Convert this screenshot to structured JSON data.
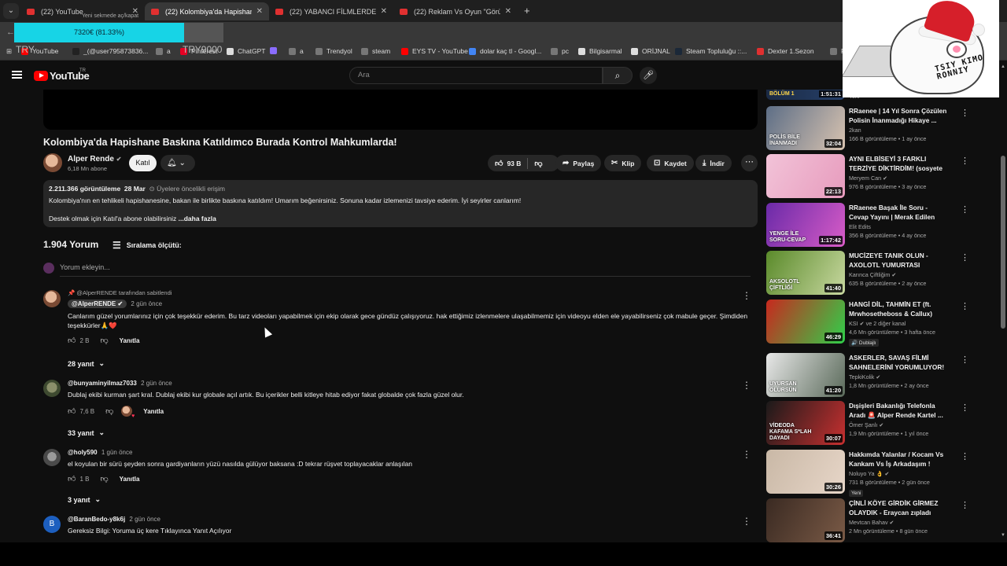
{
  "browser": {
    "tabs": [
      {
        "title": "(22) YouTube",
        "active": false
      },
      {
        "title": "(22) Kolombiya'da Hapishane B",
        "active": true
      },
      {
        "title": "(22) YABANCI FİLMLERDEKİ, TÜ",
        "active": false
      },
      {
        "title": "(22) Reklam Vs Oyun \"Göründü",
        "active": false
      }
    ],
    "new_tab": "+",
    "download_overlay_small": "Yeni sekmede aç/kapat",
    "download_progress": {
      "text": "7320€ (81.33%)",
      "fraction": 0.8133
    },
    "overlay_left": "TRY",
    "overlay_right": "TRY9000",
    "bookmarks": [
      {
        "label": "YouTube",
        "color": "#ff0000"
      },
      {
        "label": "_(@user795873836...",
        "color": "#222222"
      },
      {
        "label": "a",
        "color": "#777777"
      },
      {
        "label": "Pinterest",
        "color": "#e60023"
      },
      {
        "label": "ChatGPT",
        "color": "#dddddd"
      },
      {
        "label": "",
        "color": "#8a6cff"
      },
      {
        "label": "a",
        "color": "#777777"
      },
      {
        "label": "Trendyol",
        "color": "#777777"
      },
      {
        "label": "steam",
        "color": "#777777"
      },
      {
        "label": "EYS TV - YouTube",
        "color": "#ff0000"
      },
      {
        "label": "dolar kaç tl - Googl...",
        "color": "#4285f4"
      },
      {
        "label": "pc",
        "color": "#777777"
      },
      {
        "label": "Bilgisarmal",
        "color": "#dddddd"
      },
      {
        "label": "ORİJNAL",
        "color": "#dddddd"
      },
      {
        "label": "Steam Topluluğu ::...",
        "color": "#1b2838"
      },
      {
        "label": "Dexter 1.Sezon",
        "color": "#e03030"
      },
      {
        "label": "RDR",
        "color": "#777777"
      }
    ]
  },
  "youtube": {
    "logo_text": "YouTube",
    "country": "TR",
    "search_placeholder": "Ara",
    "video": {
      "title": "Kolombiya'da Hapishane Baskına Katıldımco Burada Kontrol Mahkumlarda!",
      "channel": "Alper Rende",
      "subscribers": "6,18 Mn abone",
      "join_label": "Katıl",
      "likes": "93 B",
      "share_label": "Paylaş",
      "clip_label": "Klip",
      "save_label": "Kaydet",
      "download_label": "İndir",
      "views": "2.211.366 görüntüleme",
      "date": "28 Mar",
      "members_note": "⊙ Üyelere öncelikli erişim",
      "description_line1": "Kolombiya'nın en tehlikeli hapishanesine, bakan ile birlikte baskına katıldım! Umarım beğenirsiniz. Sonuna kadar izlemenizi tavsiye ederim. İyi seyirler canlarım!",
      "description_line2": "Destek olmak için Katıl'a abone olabilirsiniz",
      "more_label": "...daha fazla"
    },
    "comments_header": {
      "count": "1.904 Yorum",
      "sort_label": "Sıralama ölçütü:",
      "add_placeholder": "Yorum ekleyin..."
    },
    "comments": [
      {
        "pinned": "📌 @AlperRENDE tarafından sabitlendi",
        "author": "@AlperRENDE ✔",
        "time": "2 gün önce",
        "text": "Canlarım güzel yorumlarınız için çok teşekkür ederim. Bu tarz videoları yapabilmek için ekip olarak gece gündüz çalışıyoruz. hak ettiğimiz izlenmelere ulaşabilmemiz için videoyu elden ele yayabilirseniz çok mabule geçer. Şimdiden teşekkürler🙏❤️",
        "likes": "2 B",
        "reply_label": "Yanıtla",
        "replies": "28 yanıt"
      },
      {
        "author": "@bunyaminyilmaz7033",
        "time": "2 gün önce",
        "text": "Dublaj ekibi kurman şart kral. Dublaj ekibi kur globale açıl artık. Bu içerikler belli kitleye hitab ediyor fakat globalde çok fazla güzel olur.",
        "likes": "7,6 B",
        "reply_label": "Yanıtla",
        "replies": "33 yanıt"
      },
      {
        "author": "@holy590",
        "time": "1 gün önce",
        "text": "el koyulan bir sürü şeyden sonra gardiyanların yüzü nasılda gülüyor baksana :D tekrar rüşvet toplayacaklar anlaşılan",
        "likes": "1 B",
        "reply_label": "Yanıtla",
        "replies": "3 yanıt"
      },
      {
        "author": "@BaranBedo-y8k6j",
        "time": "2 gün önce",
        "text": "Gereksiz Bilgi: Yoruma üç kere Tıklayınca Yanıt Açılıyor",
        "avatar_letter": "B"
      }
    ],
    "sidebar_partial": {
      "duration": "1:51:31",
      "caption": "BÖLÜM 1",
      "meta": "Yeni"
    },
    "sidebar": [
      {
        "title": "RRaenee | 14 Yıl Sonra Çözülen Polisin İnanmadığı Hikaye ...",
        "channel": "2kan",
        "meta": "166 B görüntüleme • 1 ay önce",
        "duration": "32:04",
        "caption": "POLİS BİLE İNANMADI",
        "c1": "#5d6e86",
        "c2": "#d8c3b0"
      },
      {
        "title": "AYNI ELBİSEYİ 3 FARKLI TERZİYE DİKTİRDİM! (sosyete ...",
        "channel": "Meryem Can ✔",
        "meta": "976 B görüntüleme • 3 ay önce",
        "duration": "22:13",
        "caption": "",
        "c1": "#f2c3d8",
        "c2": "#e79bbd"
      },
      {
        "title": "RRaenee Başak İle Soru - Cevap Yayını | Merak Edilen Tüm ...",
        "channel": "Elit Edits",
        "meta": "356 B görüntüleme • 4 ay önce",
        "duration": "1:17:42",
        "caption": "YENGE İLE SORU-CEVAP",
        "c1": "#6a2aa8",
        "c2": "#d85cc7"
      },
      {
        "title": "MUCİZEYE TANIK OLUN - AXOLOTL YUMURTASI",
        "channel": "Karınca Çiftliğim ✔",
        "meta": "635 B görüntüleme • 2 ay önce",
        "duration": "41:40",
        "caption": "AKSOLOTL ÇİFTLİĞİ",
        "c1": "#5a8a2a",
        "c2": "#c8d8a0"
      },
      {
        "title": "HANGİ DİL, TAHMİN ET (ft. Mrwhosetheboss & Callux)",
        "channel": "KSI ✔ ve 2 diğer kanal",
        "meta": "4,6 Mn görüntüleme • 3 hafta önce",
        "duration": "46:29",
        "caption": "",
        "badge": "🔊 Dublajlı",
        "c1": "#c8281e",
        "c2": "#2fd04a"
      },
      {
        "title": "ASKERLER, SAVAŞ FİLMİ SAHNELERİNİ YORUMLUYOR!",
        "channel": "TepkiKolik ✔",
        "meta": "1,8 Mn görüntüleme • 2 ay önce",
        "duration": "41:20",
        "caption": "UYURSAN ÖLÜRSÜN",
        "c1": "#e8e8e8",
        "c2": "#5a6a5a"
      },
      {
        "title": "Dışişleri Bakanlığı Telefonla Aradı 🚨 Alper Rende Kartel ...",
        "channel": "Ömer Şanlı ✔",
        "meta": "1,9 Mn görüntüleme • 1 yıl önce",
        "duration": "30:07",
        "caption": "VİDEODA KAFAMA S*LAH DAYADI",
        "c1": "#1a1a1a",
        "c2": "#c83030"
      },
      {
        "title": "Hakkımda Yalanlar / Kocam Vs Kankam Vs İş Arkadaşım !",
        "channel": "Noluyo Ya 👌 ✔",
        "meta": "731 B görüntüleme • 2 gün önce",
        "duration": "30:26",
        "caption": "",
        "badge": "Yeni",
        "c1": "#c9b8a6",
        "c2": "#e7d6c8"
      },
      {
        "title": "ÇİNLİ KÖYE GİRDİK GİRMEZ OLAYDIK - Eraycan zıpladı",
        "channel": "Mevtcan Bahav ✔",
        "meta": "2 Mn görüntüleme • 8 gün önce",
        "duration": "36:41",
        "caption": "",
        "c1": "#3a2a22",
        "c2": "#7a5a46"
      }
    ]
  },
  "sticker": {
    "text": "TSIY KIMO RONNIY"
  },
  "colors": {
    "accent": "#ff0000",
    "progress": "#17d4e6",
    "background": "#0f0f0f"
  }
}
